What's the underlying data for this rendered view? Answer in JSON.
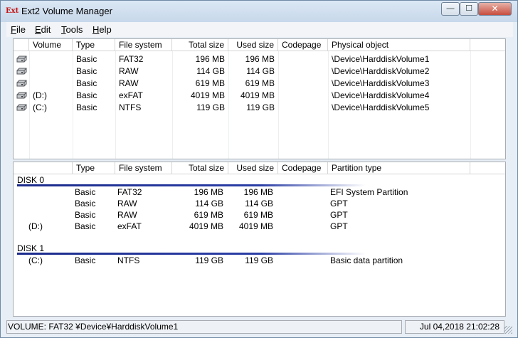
{
  "window": {
    "title": "Ext2 Volume Manager",
    "app_icon_text": "Ext",
    "minimize_glyph": "—",
    "maximize_glyph": "☐",
    "close_glyph": "✕"
  },
  "menu": {
    "items": [
      {
        "acc": "F",
        "rest": "ile"
      },
      {
        "acc": "E",
        "rest": "dit"
      },
      {
        "acc": "T",
        "rest": "ools"
      },
      {
        "acc": "H",
        "rest": "elp"
      }
    ]
  },
  "volumes": {
    "headers": [
      "Volume",
      "Type",
      "File system",
      "Total size",
      "Used size",
      "Codepage",
      "Physical object"
    ],
    "rows": [
      {
        "volume": "",
        "type": "Basic",
        "fs": "FAT32",
        "total": "196 MB",
        "used": "196 MB",
        "codepage": "",
        "physical": "\\Device\\HarddiskVolume1"
      },
      {
        "volume": "",
        "type": "Basic",
        "fs": "RAW",
        "total": "114 GB",
        "used": "114 GB",
        "codepage": "",
        "physical": "\\Device\\HarddiskVolume2"
      },
      {
        "volume": "",
        "type": "Basic",
        "fs": "RAW",
        "total": "619 MB",
        "used": "619 MB",
        "codepage": "",
        "physical": "\\Device\\HarddiskVolume3"
      },
      {
        "volume": "(D:)",
        "type": "Basic",
        "fs": "exFAT",
        "total": "4019 MB",
        "used": "4019 MB",
        "codepage": "",
        "physical": "\\Device\\HarddiskVolume4"
      },
      {
        "volume": "(C:)",
        "type": "Basic",
        "fs": "NTFS",
        "total": "119 GB",
        "used": "119 GB",
        "codepage": "",
        "physical": "\\Device\\HarddiskVolume5"
      }
    ]
  },
  "partitions": {
    "headers": [
      "",
      "Type",
      "File system",
      "Total size",
      "Used size",
      "Codepage",
      "Partition type"
    ],
    "disks": [
      {
        "label": "DISK 0",
        "rows": [
          {
            "volume": "",
            "type": "Basic",
            "fs": "FAT32",
            "total": "196 MB",
            "used": "196 MB",
            "codepage": "",
            "ptype": "EFI System Partition"
          },
          {
            "volume": "",
            "type": "Basic",
            "fs": "RAW",
            "total": "114 GB",
            "used": "114 GB",
            "codepage": "",
            "ptype": "GPT"
          },
          {
            "volume": "",
            "type": "Basic",
            "fs": "RAW",
            "total": "619 MB",
            "used": "619 MB",
            "codepage": "",
            "ptype": "GPT"
          },
          {
            "volume": "(D:)",
            "type": "Basic",
            "fs": "exFAT",
            "total": "4019 MB",
            "used": "4019 MB",
            "codepage": "",
            "ptype": "GPT"
          }
        ]
      },
      {
        "label": "DISK 1",
        "rows": [
          {
            "volume": "(C:)",
            "type": "Basic",
            "fs": "NTFS",
            "total": "119 GB",
            "used": "119 GB",
            "codepage": "",
            "ptype": "Basic data partition"
          }
        ]
      }
    ]
  },
  "status": {
    "left": "VOLUME:  FAT32 ¥Device¥HarddiskVolume1",
    "right": "Jul 04,2018 21:02:28"
  }
}
